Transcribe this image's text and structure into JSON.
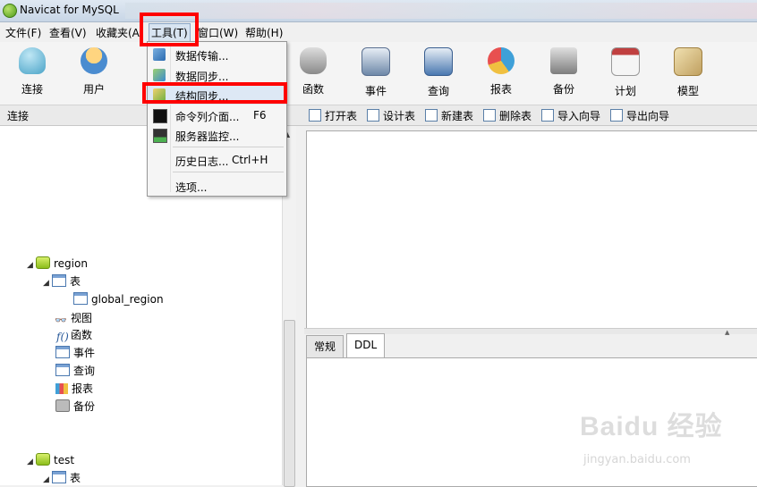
{
  "window": {
    "title": "Navicat for MySQL"
  },
  "menubar": {
    "items": [
      "文件(F)",
      "查看(V)",
      "收藏夹(A)",
      "工具(T)",
      "窗口(W)",
      "帮助(H)"
    ]
  },
  "toolbar": {
    "buttons": [
      {
        "label": "连接",
        "icon": "connection-icon",
        "color": "#4aa3c7"
      },
      {
        "label": "用户",
        "icon": "user-icon",
        "color": "#f0a030"
      },
      {
        "label": "函数",
        "icon": "function-icon",
        "color": "#8a8a8a"
      },
      {
        "label": "事件",
        "icon": "event-icon",
        "color": "#6e88a8"
      },
      {
        "label": "查询",
        "icon": "query-icon",
        "color": "#4a78b0"
      },
      {
        "label": "报表",
        "icon": "report-icon",
        "color": "#3fa0d8"
      },
      {
        "label": "备份",
        "icon": "backup-icon",
        "color": "#7d7d7d"
      },
      {
        "label": "计划",
        "icon": "schedule-icon",
        "color": "#c04040"
      },
      {
        "label": "模型",
        "icon": "model-icon",
        "color": "#c0a060"
      }
    ]
  },
  "subbar": {
    "connection_label": "连接",
    "actions": [
      "打开表",
      "设计表",
      "新建表",
      "删除表",
      "导入向导",
      "导出向导"
    ]
  },
  "tools_menu": {
    "items": [
      {
        "label": "数据传输...",
        "shortcut": "",
        "icon": "data-transfer-icon"
      },
      {
        "label": "数据同步...",
        "shortcut": "",
        "icon": "data-sync-icon"
      },
      {
        "label": "结构同步...",
        "shortcut": "",
        "icon": "structure-sync-icon"
      },
      {
        "label": "命令列介面...",
        "shortcut": "F6",
        "icon": "console-icon"
      },
      {
        "label": "服务器监控...",
        "shortcut": "",
        "icon": "server-monitor-icon"
      },
      {
        "label": "历史日志...",
        "shortcut": "Ctrl+H",
        "icon": ""
      },
      {
        "label": "选项...",
        "shortcut": "",
        "icon": ""
      }
    ]
  },
  "tree": {
    "db1": "region",
    "tables_label": "表",
    "table1": "global_region",
    "views": "视图",
    "functions": "函数",
    "events": "事件",
    "queries": "查询",
    "reports": "报表",
    "backups": "备份",
    "db2": "test",
    "tables_label2": "表"
  },
  "tabs": [
    "常规",
    "DDL"
  ],
  "watermark": {
    "main": "Baidu 经验",
    "sub": "jingyan.baidu.com"
  },
  "highlight_color": "#ff0000"
}
